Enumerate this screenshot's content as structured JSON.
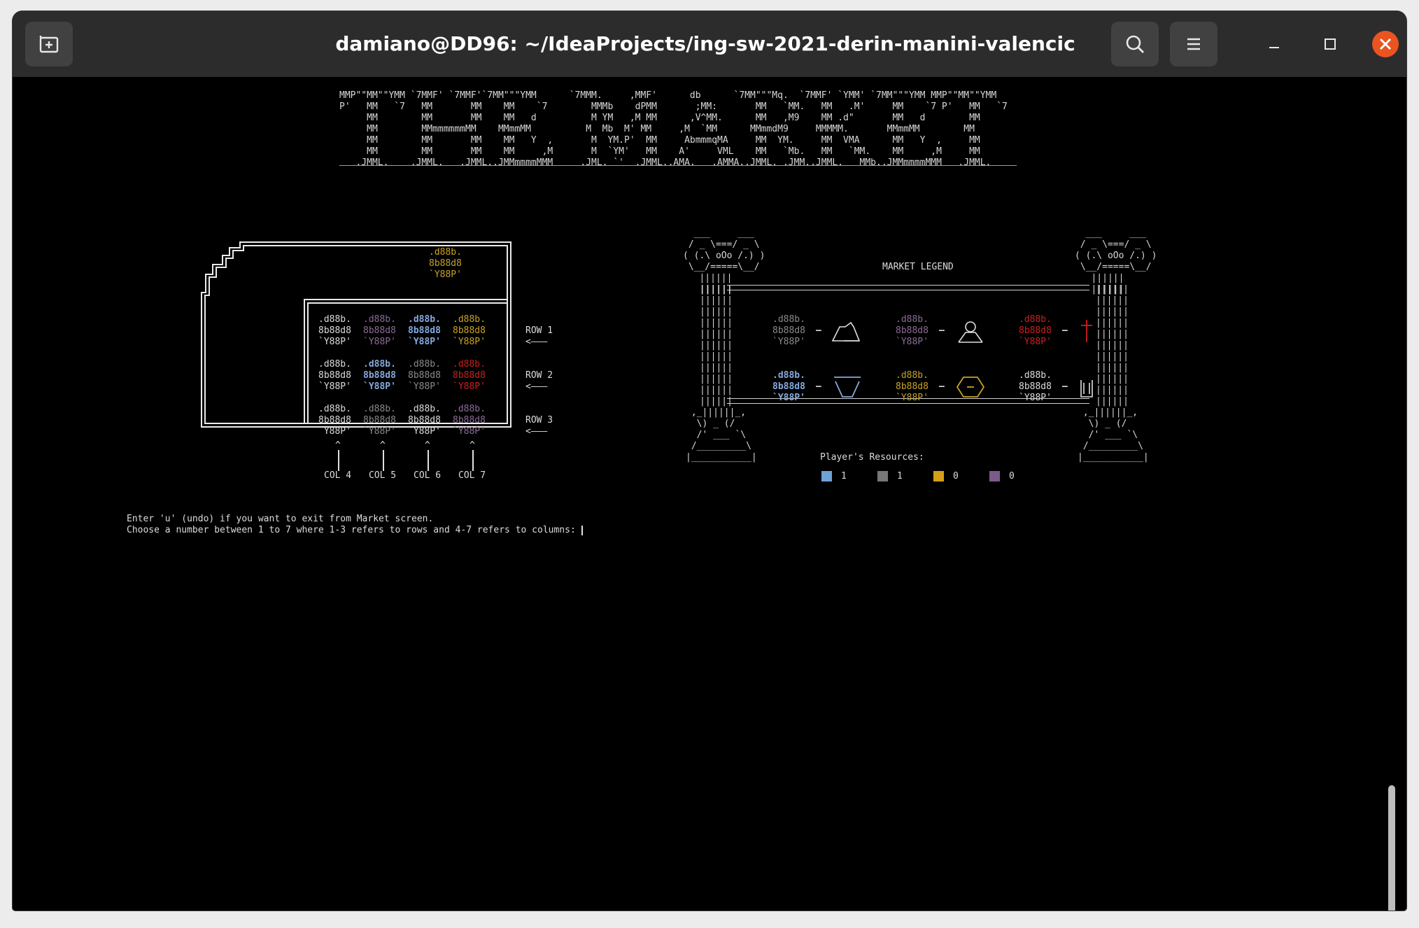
{
  "window": {
    "title": "damiano@DD96: ~/IdeaProjects/ing-sw-2021-derin-manini-valencic",
    "new_tab_icon": "new-tab-icon",
    "search_icon": "search-icon",
    "menu_icon": "hamburger-menu-icon",
    "minimize_icon": "minimize-icon",
    "maximize_icon": "maximize-icon",
    "close_icon": "close-icon",
    "close_color": "#e95420"
  },
  "banner": {
    "lines": [
      "MMP\"\"MM\"\"YMM `7MMF' `7MMF'`7MM\"\"\"YMM      `7MMM.     ,MMF'      db      `7MM\"\"\"Mq.  `7MMF' `YMM' `7MM\"\"\"YMM MMP\"\"MM\"\"YMM",
      "P'   MM   `7   MM       MM    MM    `7        MMMb    dPMM       ;MM:       MM   `MM.   MM   .M'     MM    `7 P'   MM   `7",
      "     MM        MM       MM    MM   d          M YM   ,M MM      ,V^MM.      MM   ,M9    MM .d\"       MM   d        MM",
      "     MM        MMmmmmmmMM    MMmmMM          M  Mb  M' MM     ,M  `MM      MMmmdM9     MMMMM.       MMmmMM        MM",
      "     MM        MM       MM    MM   Y  ,       M  YM.P'  MM     AbmmmqMA     MM  YM.     MM  VMA      MM   Y  ,     MM",
      "     MM        MM       MM    MM     ,M       M  `YM'   MM    A'     VML    MM   `Mb.   MM   `MM.    MM     ,M     MM",
      "   .JMML.    .JMML.   .JMML..JMMmmmmMMM     .JML. `'  .JMML..AMA.   .AMMA..JMML. .JMM..JMML.   MMb..JMMmmmmMMM   .JMML."
    ]
  },
  "market": {
    "extra_marble_color": "#c9a227",
    "rows": [
      [
        "white",
        "purple",
        "blue",
        "yellow"
      ],
      [
        "white",
        "blue",
        "grey",
        "red"
      ],
      [
        "white",
        "grey",
        "white",
        "purple"
      ]
    ],
    "marble_lines": [
      ".d88b.",
      "8b88d8",
      "`Y88P'"
    ],
    "row_labels": [
      "ROW 1",
      "ROW 2",
      "ROW 3"
    ],
    "row_arrow": "<———",
    "col_labels": [
      "COL 4",
      "COL 5",
      "COL 6",
      "COL 7"
    ],
    "col_caret": "^"
  },
  "legend": {
    "title": "MARKET LEGEND",
    "entries": [
      {
        "marble": "grey",
        "resource": "stone-icon"
      },
      {
        "marble": "purple",
        "resource": "servant-icon"
      },
      {
        "marble": "red",
        "resource": "faith-cross-icon"
      },
      {
        "marble": "blue",
        "resource": "shield-icon"
      },
      {
        "marble": "yellow",
        "resource": "coin-icon"
      },
      {
        "marble": "white",
        "resource": "blank-icon"
      }
    ],
    "dash": "–"
  },
  "resources": {
    "title": "Player's Resources:",
    "items": [
      {
        "color": "#6fa3d8",
        "value": "1"
      },
      {
        "color": "#777777",
        "value": "1"
      },
      {
        "color": "#d4a017",
        "value": "0"
      },
      {
        "color": "#7b5a8c",
        "value": "0"
      }
    ]
  },
  "prompt": {
    "line1": "Enter 'u' (undo) if you want to exit from Market screen.",
    "line2": "Choose a number between 1 to 7 where 1-3 refers to rows and 4-7 refers to columns: "
  },
  "colors": {
    "white": "#dcdcdc",
    "purple": "#8c6c96",
    "blue": "#86a8de",
    "yellow": "#c9a227",
    "grey": "#8a8a8a",
    "red": "#cc1f1f"
  }
}
